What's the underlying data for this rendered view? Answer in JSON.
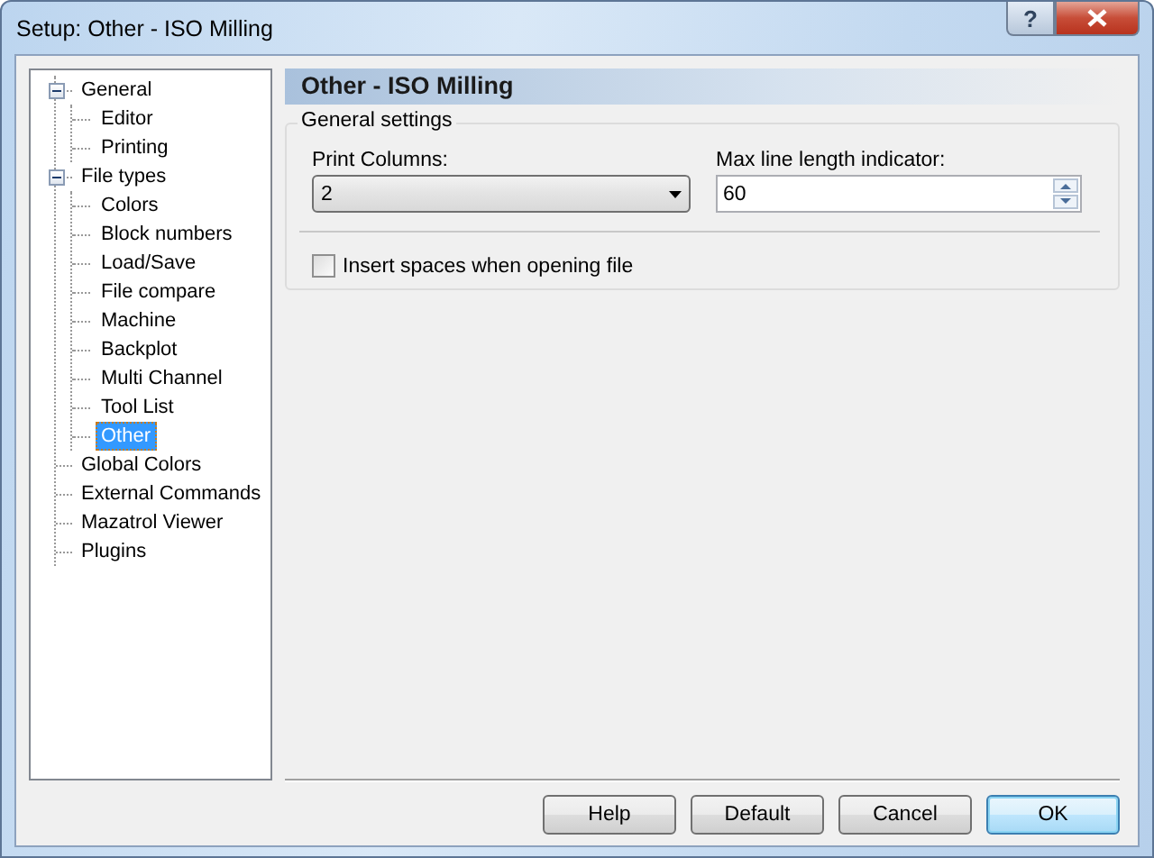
{
  "window": {
    "title": "Setup: Other - ISO Milling",
    "help_button": "?"
  },
  "tree": [
    {
      "label": "General",
      "expanded": true,
      "selected": false,
      "children": [
        {
          "label": "Editor",
          "selected": false
        },
        {
          "label": "Printing",
          "selected": false
        }
      ]
    },
    {
      "label": "File types",
      "expanded": true,
      "selected": false,
      "children": [
        {
          "label": "Colors",
          "selected": false
        },
        {
          "label": "Block numbers",
          "selected": false
        },
        {
          "label": "Load/Save",
          "selected": false
        },
        {
          "label": "File compare",
          "selected": false
        },
        {
          "label": "Machine",
          "selected": false
        },
        {
          "label": "Backplot",
          "selected": false
        },
        {
          "label": "Multi Channel",
          "selected": false
        },
        {
          "label": "Tool List",
          "selected": false
        },
        {
          "label": "Other",
          "selected": true
        }
      ]
    },
    {
      "label": "Global Colors",
      "selected": false
    },
    {
      "label": "External Commands",
      "selected": false
    },
    {
      "label": "Mazatrol Viewer",
      "selected": false
    },
    {
      "label": "Plugins",
      "selected": false
    }
  ],
  "panel": {
    "heading": "Other - ISO Milling",
    "group": {
      "title": "General settings",
      "print_columns": {
        "label": "Print Columns:",
        "value": "2"
      },
      "max_line": {
        "label": "Max line length indicator:",
        "value": "60"
      },
      "insert_spaces": {
        "label": "Insert spaces when opening file",
        "checked": false
      }
    }
  },
  "buttons": [
    {
      "label": "Help",
      "default": false
    },
    {
      "label": "Default",
      "default": false
    },
    {
      "label": "Cancel",
      "default": false
    },
    {
      "label": "OK",
      "default": true
    }
  ]
}
